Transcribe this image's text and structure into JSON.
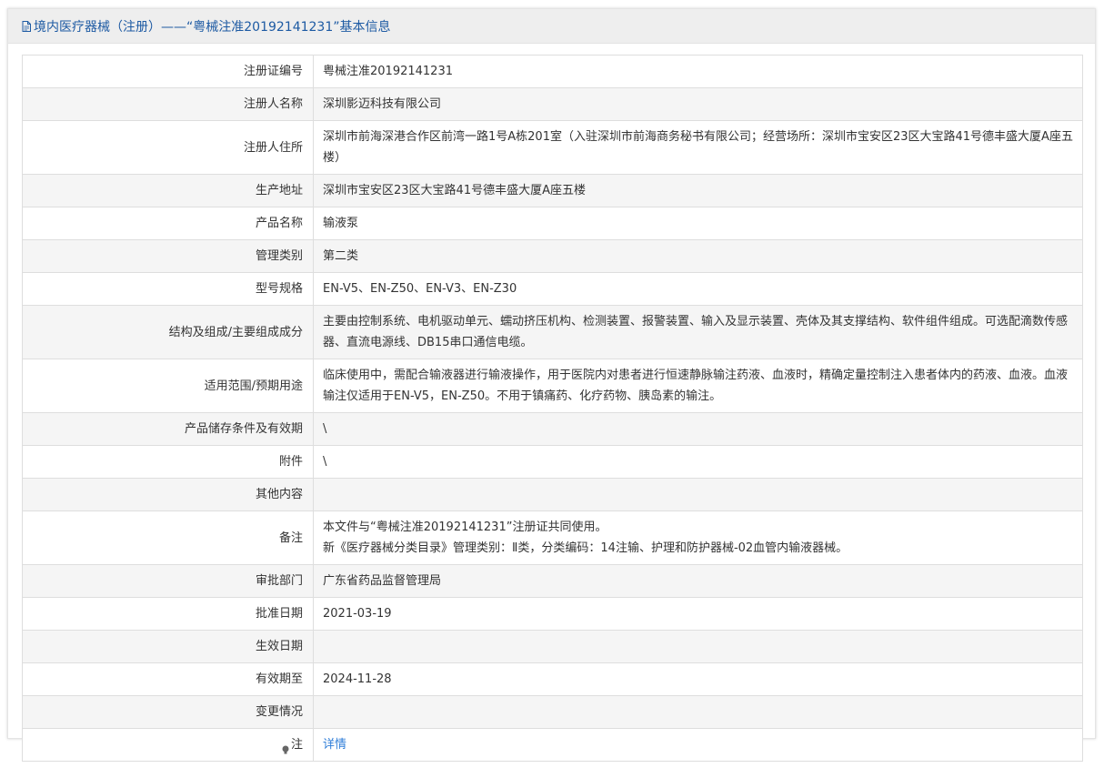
{
  "header": {
    "title": "境内医疗器械（注册）——“粤械注准20192141231”基本信息"
  },
  "rows": [
    {
      "label": "注册证编号",
      "value": "粤械注准20192141231"
    },
    {
      "label": "注册人名称",
      "value": "深圳影迈科技有限公司"
    },
    {
      "label": "注册人住所",
      "value": "深圳市前海深港合作区前湾一路1号A栋201室（入驻深圳市前海商务秘书有限公司；经营场所：深圳市宝安区23区大宝路41号德丰盛大厦A座五楼）"
    },
    {
      "label": "生产地址",
      "value": "深圳市宝安区23区大宝路41号德丰盛大厦A座五楼"
    },
    {
      "label": "产品名称",
      "value": "输液泵"
    },
    {
      "label": "管理类别",
      "value": "第二类"
    },
    {
      "label": "型号规格",
      "value": "EN-V5、EN-Z50、EN-V3、EN-Z30"
    },
    {
      "label": "结构及组成/主要组成成分",
      "value": "主要由控制系统、电机驱动单元、蠕动挤压机构、检测装置、报警装置、输入及显示装置、壳体及其支撑结构、软件组件组成。可选配滴数传感器、直流电源线、DB15串口通信电缆。"
    },
    {
      "label": "适用范围/预期用途",
      "value": "临床使用中，需配合输液器进行输液操作，用于医院内对患者进行恒速静脉输注药液、血液时，精确定量控制注入患者体内的药液、血液。血液输注仅适用于EN-V5，EN-Z50。不用于镇痛药、化疗药物、胰岛素的输注。"
    },
    {
      "label": "产品储存条件及有效期",
      "value": "\\"
    },
    {
      "label": "附件",
      "value": "\\"
    },
    {
      "label": "其他内容",
      "value": ""
    },
    {
      "label": "备注",
      "value_lines": [
        "本文件与“粤械注准20192141231”注册证共同使用。",
        "新《医疗器械分类目录》管理类别：Ⅱ类，分类编码：14注输、护理和防护器械-02血管内输液器械。"
      ]
    },
    {
      "label": "审批部门",
      "value": "广东省药品监督管理局"
    },
    {
      "label": "批准日期",
      "value": "2021-03-19"
    },
    {
      "label": "生效日期",
      "value": ""
    },
    {
      "label": "有效期至",
      "value": "2024-11-28"
    },
    {
      "label": "变更情况",
      "value": ""
    },
    {
      "label": "注",
      "value": "详情",
      "icon": "lightbulb-icon"
    }
  ],
  "colors": {
    "header_text": "#1d5aa3",
    "link": "#2f7ed8",
    "border": "#dedede",
    "stripe": "#f5f5f5"
  }
}
